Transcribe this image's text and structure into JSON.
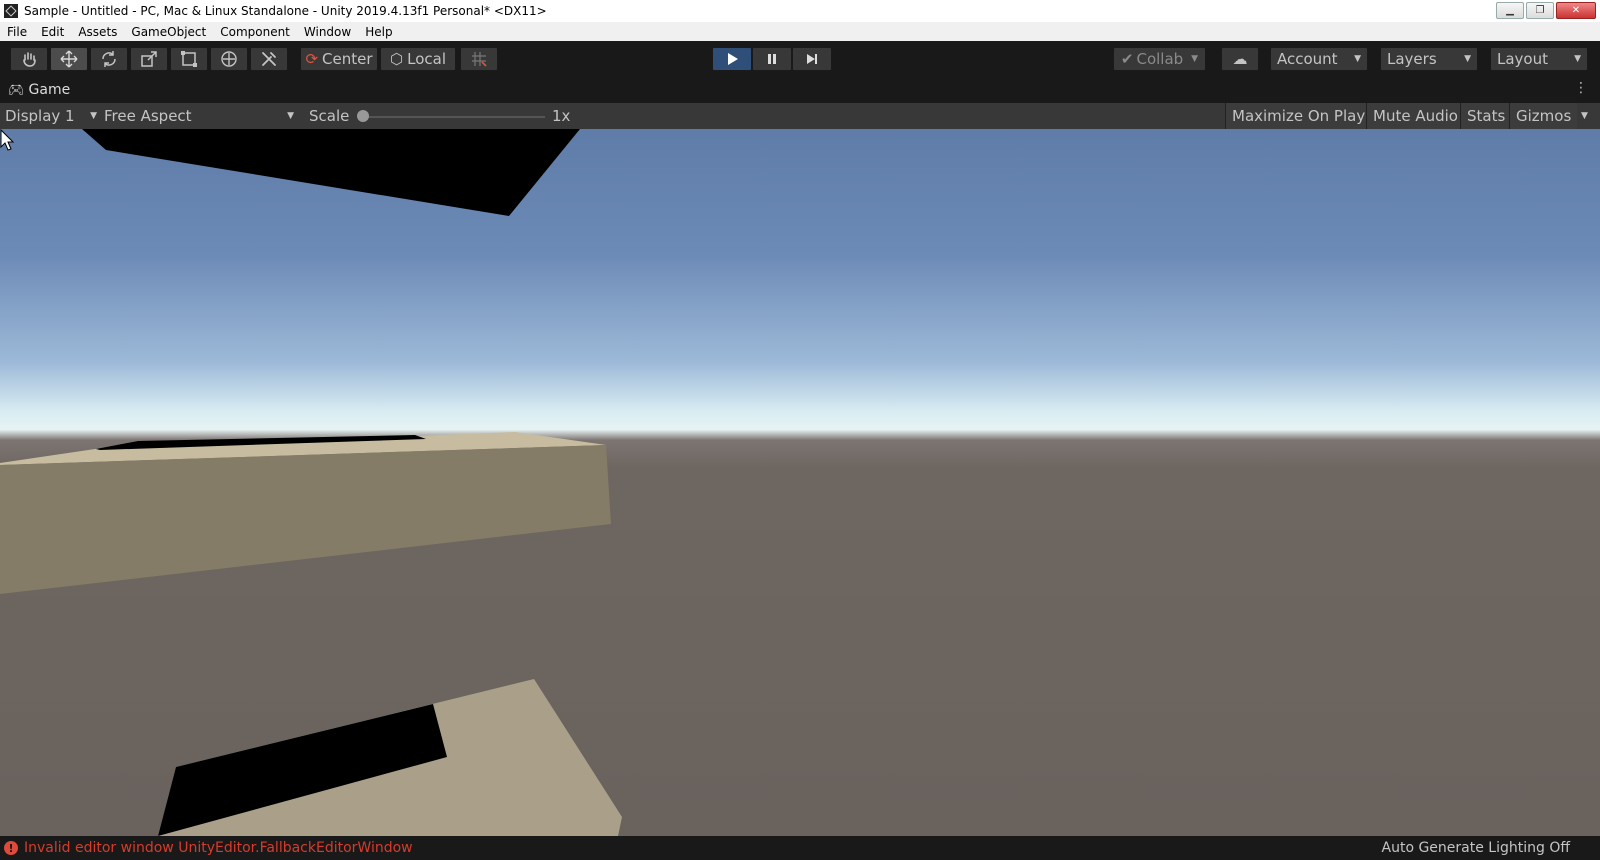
{
  "window": {
    "title": "Sample - Untitled - PC, Mac & Linux Standalone - Unity 2019.4.13f1 Personal* <DX11>",
    "controls": {
      "minimize": "▁",
      "restore": "❐",
      "close": "✕"
    }
  },
  "menu": {
    "items": [
      "File",
      "Edit",
      "Assets",
      "GameObject",
      "Component",
      "Window",
      "Help"
    ]
  },
  "toolbar": {
    "tools": [
      "hand-tool",
      "move-tool",
      "rotate-tool",
      "scale-tool",
      "rect-tool",
      "transform-tool",
      "custom-tool"
    ],
    "active_tool": "move-tool",
    "pivot_label": "Center",
    "space_label": "Local",
    "collab_label": "Collab",
    "account_label": "Account",
    "layers_label": "Layers",
    "layout_label": "Layout",
    "play_active": true
  },
  "tab": {
    "label": "Game"
  },
  "game_toolbar": {
    "display": "Display 1",
    "aspect": "Free Aspect",
    "scale_label": "Scale",
    "scale_value": "1x",
    "maximize": "Maximize On Play",
    "mute": "Mute Audio",
    "stats": "Stats",
    "gizmos": "Gizmos"
  },
  "status": {
    "error": "Invalid editor window UnityEditor.FallbackEditorWindow",
    "lighting": "Auto Generate Lighting Off"
  },
  "colors": {
    "play_button": "#2f4f78",
    "error_text": "#d63b2b",
    "ground": "#6a625d",
    "sky_top": "#5f7ca8"
  }
}
